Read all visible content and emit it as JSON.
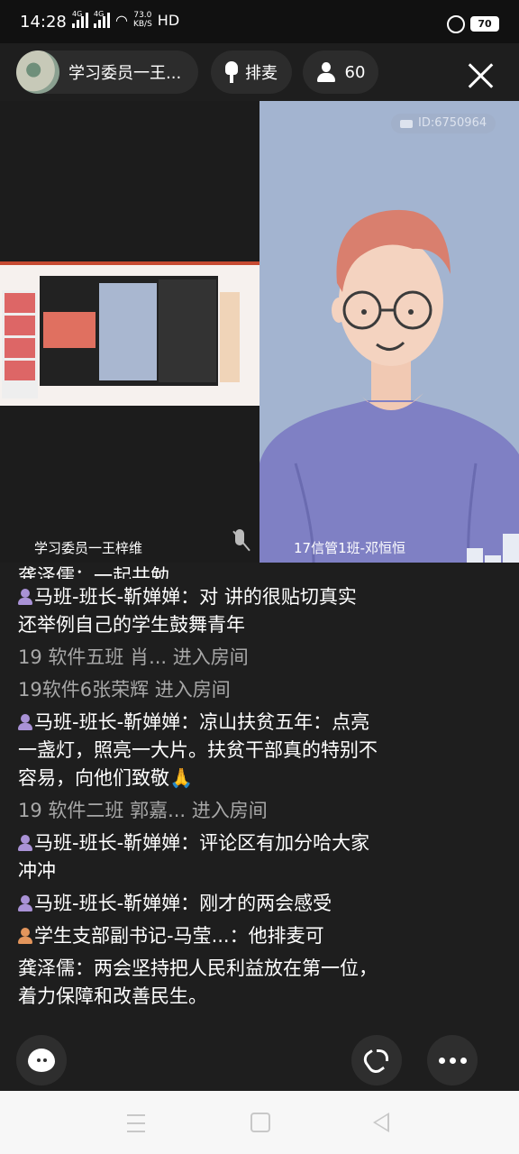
{
  "status": {
    "time": "14:28",
    "net1": "4G",
    "net2": "4G",
    "speed_value": "73.0",
    "speed_unit": "KB/S",
    "hd": "HD",
    "battery": "70"
  },
  "header": {
    "host_name": "学习委员一王...",
    "mic_queue_label": "排麦",
    "viewer_count": "60"
  },
  "left_video": {
    "label": "学习委员一王梓维"
  },
  "right_video": {
    "room_id": "ID:6750964",
    "label": "17信管1班-邓恒恒"
  },
  "chat": {
    "cut_message": "龚泽儒：一起共勉",
    "messages": [
      {
        "user": "马班-班长-靳婵婵",
        "text": "：对 讲的很贴切真实 还举例自己的学生鼓舞青年",
        "badge": "purple"
      },
      {
        "system": "19  软件五班 肖... 进入房间"
      },
      {
        "system": "19软件6张荣辉 进入房间"
      },
      {
        "user": "马班-班长-靳婵婵",
        "text": "：凉山扶贫五年：点亮一盏灯，照亮一大片。扶贫干部真的特别不容易，向他们致敬🙏",
        "badge": "purple"
      },
      {
        "system": "19 软件二班 郭嘉... 进入房间"
      },
      {
        "user": "马班-班长-靳婵婵",
        "text": "：评论区有加分哈大家冲冲",
        "badge": "purple"
      },
      {
        "user": "马班-班长-靳婵婵",
        "text": "：刚才的两会感受",
        "badge": "purple"
      },
      {
        "user": "学生支部副书记-马莹...",
        "text": "：他排麦可",
        "badge": "orange"
      },
      {
        "user": "龚泽儒",
        "text": "：两会坚持把人民利益放在第一位，着力保障和改善民生。",
        "badge": "none"
      }
    ]
  },
  "icons": {
    "close": "close-icon",
    "chat": "chat-bubble-icon",
    "phone": "phone-icon",
    "more": "more-dots-icon"
  }
}
